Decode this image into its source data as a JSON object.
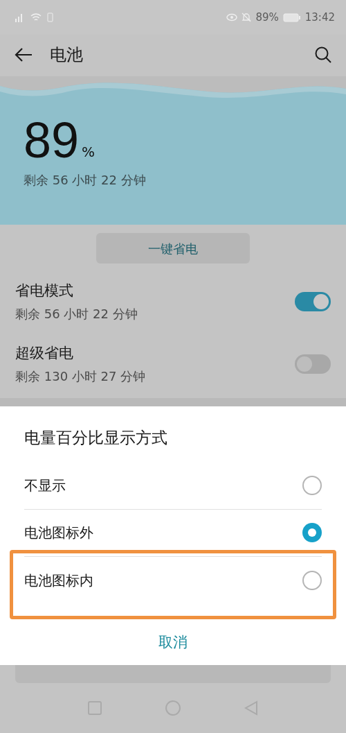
{
  "status_bar": {
    "battery_percent": "89%",
    "time": "13:42"
  },
  "header": {
    "title": "电池"
  },
  "battery": {
    "percent": "89",
    "unit": "%",
    "remaining": "剩余 56 小时 22 分钟"
  },
  "one_key_button": "一键省电",
  "modes": [
    {
      "title": "省电模式",
      "subtitle": "剩余 56 小时 22 分钟",
      "on": true
    },
    {
      "title": "超级省电",
      "subtitle": "剩余 130 小时 27 分钟",
      "on": false
    }
  ],
  "dialog": {
    "title": "电量百分比显示方式",
    "options": [
      {
        "label": "不显示",
        "selected": false,
        "highlighted": false
      },
      {
        "label": "电池图标外",
        "selected": true,
        "highlighted": false
      },
      {
        "label": "电池图标内",
        "selected": false,
        "highlighted": true
      }
    ],
    "cancel": "取消"
  }
}
